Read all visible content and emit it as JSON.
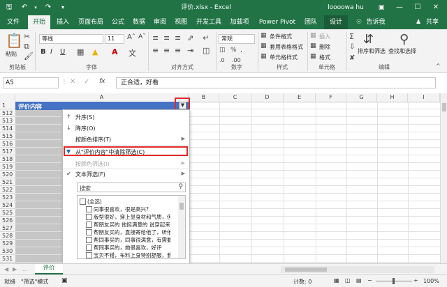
{
  "title_bar": {
    "file_title": "评价.xlsx - Excel",
    "user": "loooowa hu",
    "restore_icon": "ribbon-display-icon",
    "min": "—",
    "max": "☐",
    "close": "✕"
  },
  "tabs": [
    "文件",
    "开始",
    "插入",
    "页面布局",
    "公式",
    "数据",
    "审阅",
    "视图",
    "开发工具",
    "加载项",
    "Power Pivot",
    "团队",
    "设计"
  ],
  "tell_me": "告诉我",
  "share": "共享",
  "ribbon": {
    "paste": "粘贴",
    "clipboard": "剪贴板",
    "font_name": "等线",
    "font_size": "11",
    "bold": "B",
    "italic": "I",
    "underline": "U",
    "font_group": "字体",
    "align_group": "对齐方式",
    "number_format": "常规",
    "number_group": "数字",
    "cond_format": "条件格式",
    "table_format": "套用表格格式",
    "cell_style": "单元格样式",
    "style_group": "样式",
    "insert": "插入",
    "delete": "删除",
    "format": "格式",
    "cells_group": "单元格",
    "sort_filter": "排序和筛选",
    "find_select": "查找和选择",
    "edit_group": "编辑",
    "sum_sign": "Σ"
  },
  "formula_bar": {
    "name_box": "A5",
    "fx": "fx",
    "value": "正合适，好看"
  },
  "grid": {
    "columns": [
      "A",
      "B",
      "C",
      "D",
      "E",
      "F",
      "G",
      "H",
      "I"
    ],
    "rows": [
      "1",
      "512",
      "513",
      "514",
      "515",
      "516",
      "517",
      "518",
      "519",
      "520",
      "521",
      "522",
      "523",
      "524",
      "525",
      "526",
      "527",
      "528",
      "529",
      "530",
      "531",
      "532"
    ],
    "header_cell": "评价内容"
  },
  "filter_menu": {
    "sort_asc": "升序(S)",
    "sort_desc": "降序(O)",
    "sort_color": "按颜色排序(T)",
    "clear_filter": "从\"评价内容\"中清除筛选(C)",
    "color_filter": "按颜色筛选(I)",
    "text_filter": "文本筛选(F)",
    "search_placeholder": "搜索",
    "items": [
      "(全选)",
      "同事很喜欢，很是高兴?",
      "版型很好，穿上显身材和气质，但",
      "帮朋友买的 他挺满意的 说穿起来很",
      "帮朋友买的，直接寄给他了，听他",
      "帮同事买的，同事很满意，有需要",
      "帮同事买的，她很喜欢，好评",
      "宝贝不错，布料上身特别舒服，我"
    ],
    "ok": "确定",
    "cancel": "取消"
  },
  "sheet_tab": "评价",
  "status": {
    "ready": "就绪",
    "mode": "\"筛选\"模式",
    "count": "计数: 0",
    "zoom": "100%"
  }
}
